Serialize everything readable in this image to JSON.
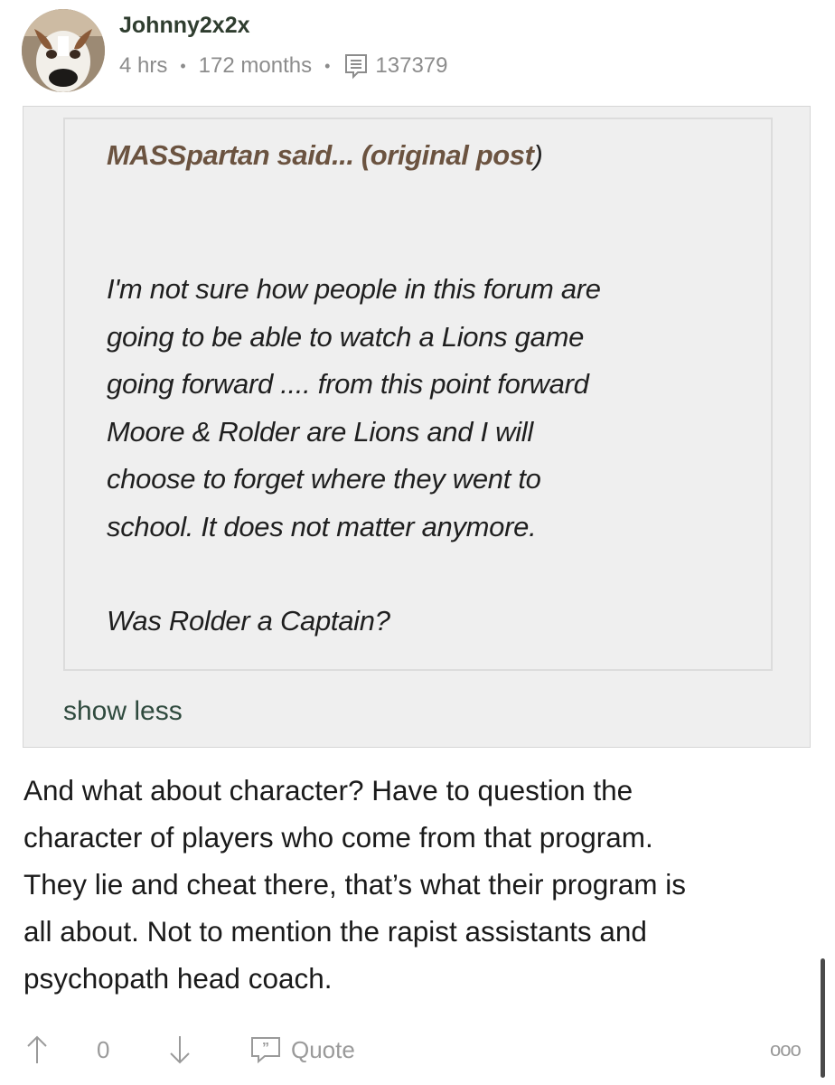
{
  "post": {
    "username": "Johnny2x2x",
    "time_ago": "4 hrs",
    "member_duration": "172 months",
    "post_count": "137379"
  },
  "quote": {
    "author_label": "MASSpartan said... ",
    "original_post_prefix": "(original post",
    "original_post_suffix": ")",
    "lines": [
      "I'm not sure how people in this forum are",
      "going to be able to watch a Lions game",
      "going forward .... from this point forward",
      "Moore & Rolder are Lions and I will",
      "choose to forget where they went to",
      "school. It does not matter anymore."
    ],
    "last_line": "Was Rolder a Captain?",
    "toggle_label": "show less"
  },
  "reply": {
    "lines": [
      "And what about character? Have to question the",
      "character of players who come from that program.",
      "They lie and cheat there, that’s what their program is",
      "all about. Not to mention the rapist assistants and",
      "psychopath head coach."
    ]
  },
  "actions": {
    "vote_count": "0",
    "quote_label": "Quote",
    "more_label": "ooo"
  },
  "icons": {
    "post_count": "post-count-icon",
    "upvote": "arrow-up-icon",
    "downvote": "arrow-down-icon",
    "quote": "quote-icon",
    "more": "more-options-icon"
  },
  "colors": {
    "username": "#2f3d2f",
    "quote_author": "#6b5340",
    "show_less": "#2f4a3e",
    "meta": "#8c8c8c"
  }
}
